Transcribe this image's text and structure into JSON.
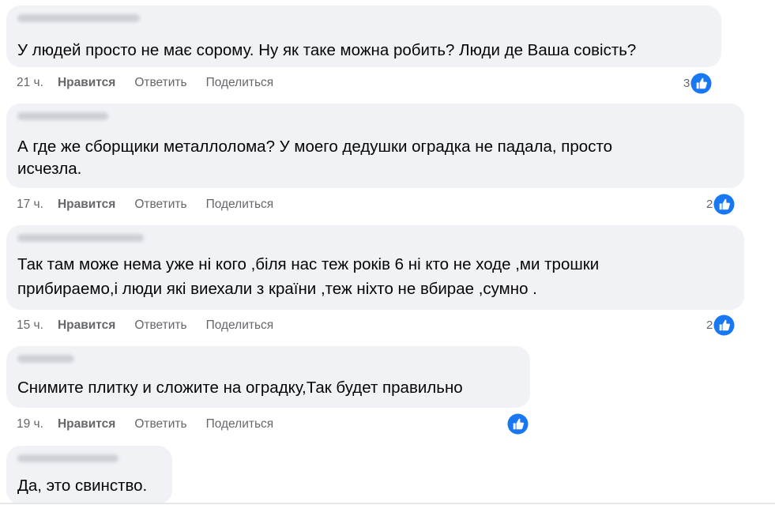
{
  "comments": [
    {
      "text_lines": [
        "У людей просто не має сорому. Ну як таке можна робить? Люди де Ваша совість?"
      ],
      "time": "21 ч.",
      "like_label": "Нравится",
      "reply_label": "Ответить",
      "share_label": "Поделиться",
      "reaction_count": "3"
    },
    {
      "text_lines": [
        "А где же сборщики металлолома? У моего дедушки оградка не падала, просто",
        "исчезла."
      ],
      "time": "17 ч.",
      "like_label": "Нравится",
      "reply_label": "Ответить",
      "share_label": "Поделиться",
      "reaction_count": "2"
    },
    {
      "text_lines": [
        "Так там може нема уже ні кого ,біля нас теж років 6 ні кто не ходе ,ми трошки",
        "прибираемо,і люди які виехали з країни ,теж ніхто не вбирае ,сумно ."
      ],
      "time": "15 ч.",
      "like_label": "Нравится",
      "reply_label": "Ответить",
      "share_label": "Поделиться",
      "reaction_count": "2"
    },
    {
      "text_lines": [
        "Снимите плитку и сложите на оградку,Так будет правильно"
      ],
      "time": "19 ч.",
      "like_label": "Нравится",
      "reply_label": "Ответить",
      "share_label": "Поделиться",
      "reaction_count": ""
    },
    {
      "text_lines": [
        "Да, это свинство."
      ]
    }
  ],
  "colors": {
    "bubble_bg": "#f0f2f5",
    "text": "#050505",
    "meta": "#65676b",
    "like_blue": "#1877f2"
  },
  "icons": {
    "reaction": "like-thumb-icon",
    "author_name": "blurred-name"
  }
}
